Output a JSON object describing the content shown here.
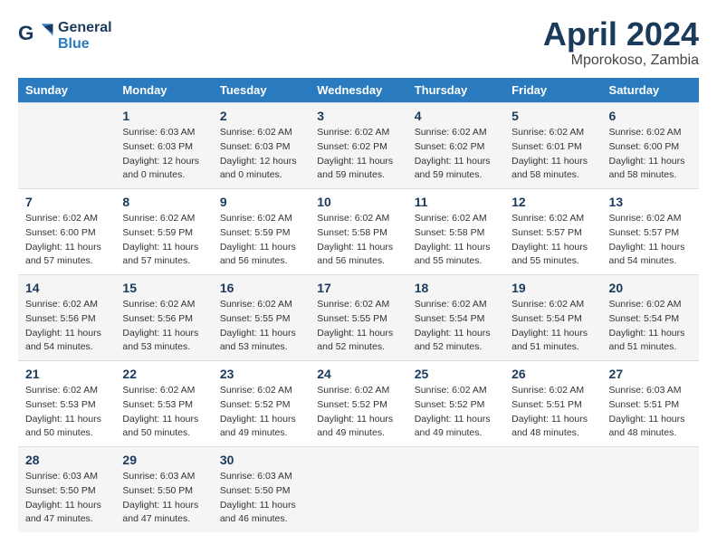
{
  "header": {
    "logo_general": "General",
    "logo_blue": "Blue",
    "month_title": "April 2024",
    "location": "Mporokoso, Zambia"
  },
  "calendar": {
    "days_of_week": [
      "Sunday",
      "Monday",
      "Tuesday",
      "Wednesday",
      "Thursday",
      "Friday",
      "Saturday"
    ],
    "weeks": [
      [
        {
          "day": "",
          "info": ""
        },
        {
          "day": "1",
          "info": "Sunrise: 6:03 AM\nSunset: 6:03 PM\nDaylight: 12 hours\nand 0 minutes."
        },
        {
          "day": "2",
          "info": "Sunrise: 6:02 AM\nSunset: 6:03 PM\nDaylight: 12 hours\nand 0 minutes."
        },
        {
          "day": "3",
          "info": "Sunrise: 6:02 AM\nSunset: 6:02 PM\nDaylight: 11 hours\nand 59 minutes."
        },
        {
          "day": "4",
          "info": "Sunrise: 6:02 AM\nSunset: 6:02 PM\nDaylight: 11 hours\nand 59 minutes."
        },
        {
          "day": "5",
          "info": "Sunrise: 6:02 AM\nSunset: 6:01 PM\nDaylight: 11 hours\nand 58 minutes."
        },
        {
          "day": "6",
          "info": "Sunrise: 6:02 AM\nSunset: 6:00 PM\nDaylight: 11 hours\nand 58 minutes."
        }
      ],
      [
        {
          "day": "7",
          "info": "Sunrise: 6:02 AM\nSunset: 6:00 PM\nDaylight: 11 hours\nand 57 minutes."
        },
        {
          "day": "8",
          "info": "Sunrise: 6:02 AM\nSunset: 5:59 PM\nDaylight: 11 hours\nand 57 minutes."
        },
        {
          "day": "9",
          "info": "Sunrise: 6:02 AM\nSunset: 5:59 PM\nDaylight: 11 hours\nand 56 minutes."
        },
        {
          "day": "10",
          "info": "Sunrise: 6:02 AM\nSunset: 5:58 PM\nDaylight: 11 hours\nand 56 minutes."
        },
        {
          "day": "11",
          "info": "Sunrise: 6:02 AM\nSunset: 5:58 PM\nDaylight: 11 hours\nand 55 minutes."
        },
        {
          "day": "12",
          "info": "Sunrise: 6:02 AM\nSunset: 5:57 PM\nDaylight: 11 hours\nand 55 minutes."
        },
        {
          "day": "13",
          "info": "Sunrise: 6:02 AM\nSunset: 5:57 PM\nDaylight: 11 hours\nand 54 minutes."
        }
      ],
      [
        {
          "day": "14",
          "info": "Sunrise: 6:02 AM\nSunset: 5:56 PM\nDaylight: 11 hours\nand 54 minutes."
        },
        {
          "day": "15",
          "info": "Sunrise: 6:02 AM\nSunset: 5:56 PM\nDaylight: 11 hours\nand 53 minutes."
        },
        {
          "day": "16",
          "info": "Sunrise: 6:02 AM\nSunset: 5:55 PM\nDaylight: 11 hours\nand 53 minutes."
        },
        {
          "day": "17",
          "info": "Sunrise: 6:02 AM\nSunset: 5:55 PM\nDaylight: 11 hours\nand 52 minutes."
        },
        {
          "day": "18",
          "info": "Sunrise: 6:02 AM\nSunset: 5:54 PM\nDaylight: 11 hours\nand 52 minutes."
        },
        {
          "day": "19",
          "info": "Sunrise: 6:02 AM\nSunset: 5:54 PM\nDaylight: 11 hours\nand 51 minutes."
        },
        {
          "day": "20",
          "info": "Sunrise: 6:02 AM\nSunset: 5:54 PM\nDaylight: 11 hours\nand 51 minutes."
        }
      ],
      [
        {
          "day": "21",
          "info": "Sunrise: 6:02 AM\nSunset: 5:53 PM\nDaylight: 11 hours\nand 50 minutes."
        },
        {
          "day": "22",
          "info": "Sunrise: 6:02 AM\nSunset: 5:53 PM\nDaylight: 11 hours\nand 50 minutes."
        },
        {
          "day": "23",
          "info": "Sunrise: 6:02 AM\nSunset: 5:52 PM\nDaylight: 11 hours\nand 49 minutes."
        },
        {
          "day": "24",
          "info": "Sunrise: 6:02 AM\nSunset: 5:52 PM\nDaylight: 11 hours\nand 49 minutes."
        },
        {
          "day": "25",
          "info": "Sunrise: 6:02 AM\nSunset: 5:52 PM\nDaylight: 11 hours\nand 49 minutes."
        },
        {
          "day": "26",
          "info": "Sunrise: 6:02 AM\nSunset: 5:51 PM\nDaylight: 11 hours\nand 48 minutes."
        },
        {
          "day": "27",
          "info": "Sunrise: 6:03 AM\nSunset: 5:51 PM\nDaylight: 11 hours\nand 48 minutes."
        }
      ],
      [
        {
          "day": "28",
          "info": "Sunrise: 6:03 AM\nSunset: 5:50 PM\nDaylight: 11 hours\nand 47 minutes."
        },
        {
          "day": "29",
          "info": "Sunrise: 6:03 AM\nSunset: 5:50 PM\nDaylight: 11 hours\nand 47 minutes."
        },
        {
          "day": "30",
          "info": "Sunrise: 6:03 AM\nSunset: 5:50 PM\nDaylight: 11 hours\nand 46 minutes."
        },
        {
          "day": "",
          "info": ""
        },
        {
          "day": "",
          "info": ""
        },
        {
          "day": "",
          "info": ""
        },
        {
          "day": "",
          "info": ""
        }
      ]
    ]
  }
}
